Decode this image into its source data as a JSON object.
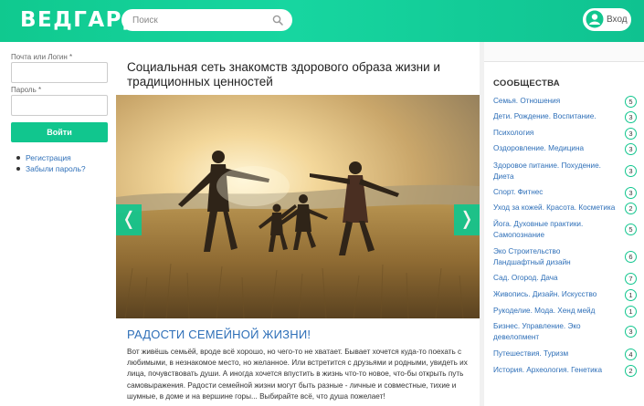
{
  "header": {
    "logo": "ВЕДГАРД",
    "search_placeholder": "Поиск",
    "login_label": "Вход"
  },
  "login_form": {
    "login_label": "Почта или Логин *",
    "password_label": "Пароль *",
    "submit_label": "Войти",
    "links": [
      "Регистрация",
      "Забыли пароль?"
    ]
  },
  "main": {
    "title": "Социальная сеть знакомств здорового образа жизни и традиционных ценностей",
    "slider_prev": "❬",
    "slider_next": "❭",
    "article_title": "РАДОСТИ СЕМЕЙНОЙ ЖИЗНИ!",
    "article_text": "Вот живёшь семьёй, вроде всё хорошо, но чего-то не хватает. Бывает хочется куда-то поехать с любимыми, в незнакомое место, но желанное. Или встретится с друзьями и родными, увидеть их лица, почувствовать души. А иногда хочется впустить в  жизнь что-то новое, что-бы открыть путь самовыражения. Радости семейной жизни могут быть разные - личные и совместные, тихие и шумные, в доме и на вершине горы... Выбирайте всё, что душа пожелает!"
  },
  "sidebar": {
    "title": "СООБЩЕСТВА",
    "communities": [
      {
        "name": "Семья. Отношения",
        "count": "5"
      },
      {
        "name": "Дети. Рождение. Воспитание.",
        "count": "3"
      },
      {
        "name": "Психология",
        "count": "3"
      },
      {
        "name": "Оздоровление. Медицина",
        "count": "3"
      },
      {
        "name": "Здоровое питание. Похудение. Диета",
        "count": "3"
      },
      {
        "name": "Спорт. Фитнес",
        "count": "3"
      },
      {
        "name": "Уход за кожей. Красота. Косметика",
        "count": "2"
      },
      {
        "name": "Йога. Духовные практики. Самопознание",
        "count": "5"
      },
      {
        "name": "Эко Строительство Ландшафтный дизайн",
        "count": "6"
      },
      {
        "name": "Сад. Огород. Дача",
        "count": "7"
      },
      {
        "name": "Живопись. Дизайн. Искусство",
        "count": "1"
      },
      {
        "name": "Рукоделие. Мода. Хенд мейд",
        "count": "1"
      },
      {
        "name": "Бизнес. Управление. Эко девелопмент",
        "count": "3"
      },
      {
        "name": "Путешествия. Туризм",
        "count": "4"
      },
      {
        "name": "История. Археология. Генетика",
        "count": "2"
      }
    ]
  },
  "colors": {
    "brand": "#11c68e",
    "link": "#2e6fb8"
  }
}
